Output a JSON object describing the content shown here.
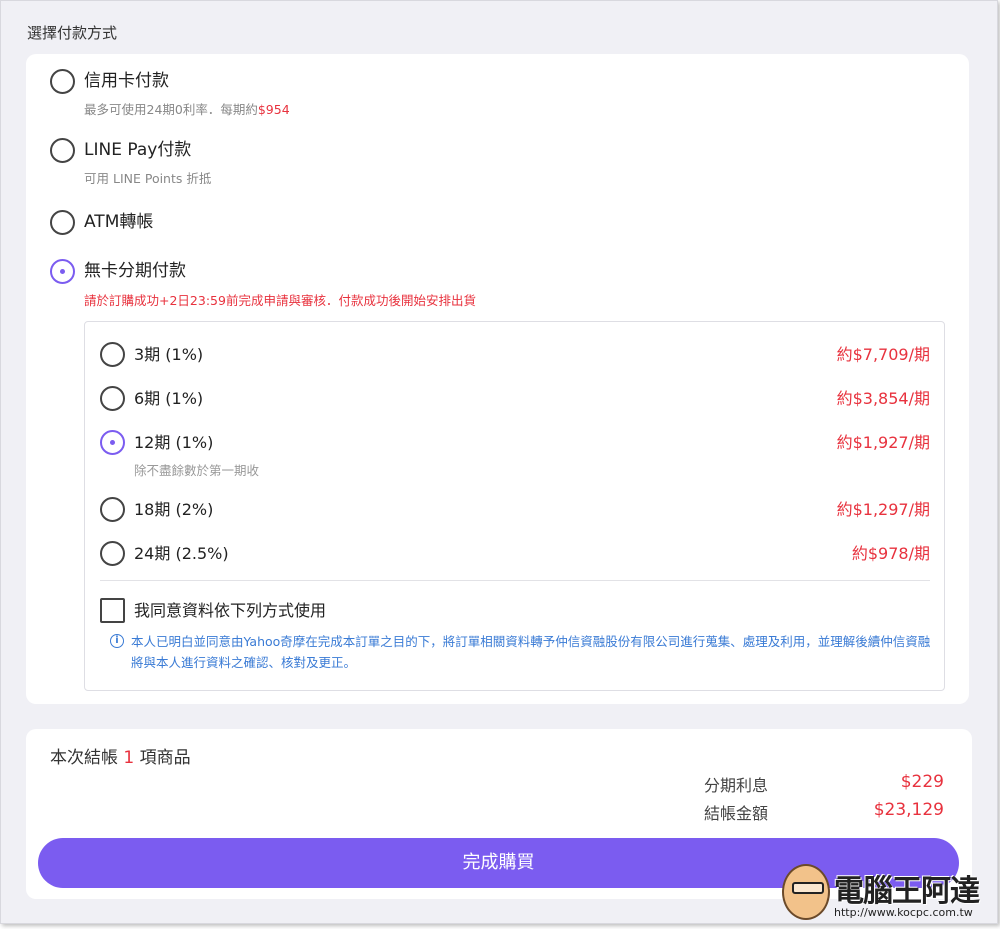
{
  "section_title": "選擇付款方式",
  "payment_methods": [
    {
      "label": "信用卡付款",
      "sub_prefix": "最多可使用24期0利率．每期約",
      "sub_amount": "$954",
      "selected": false
    },
    {
      "label": "LINE Pay付款",
      "sub": "可用 LINE Points 折抵",
      "selected": false
    },
    {
      "label": "ATM轉帳",
      "selected": false
    },
    {
      "label": "無卡分期付款",
      "sub_warning": "請於訂購成功+2日23:59前完成申請與審核．付款成功後開始安排出貨",
      "selected": true
    }
  ],
  "installments": [
    {
      "label": "3期 (1%)",
      "price": "約$7,709/期",
      "selected": false
    },
    {
      "label": "6期 (1%)",
      "price": "約$3,854/期",
      "selected": false
    },
    {
      "label": "12期 (1%)",
      "price": "約$1,927/期",
      "note": "除不盡餘數於第一期收",
      "selected": true
    },
    {
      "label": "18期 (2%)",
      "price": "約$1,297/期",
      "selected": false
    },
    {
      "label": "24期 (2.5%)",
      "price": "約$978/期",
      "selected": false
    }
  ],
  "consent": {
    "label": "我同意資料依下列方式使用",
    "info_icon": "info-icon",
    "info_text": "本人已明白並同意由Yahoo奇摩在完成本訂單之目的下，將訂單相關資料轉予仲信資融股份有限公司進行蒐集、處理及利用，並理解後續仲信資融將與本人進行資料之確認、核對及更正。"
  },
  "summary": {
    "title_prefix": "本次結帳",
    "count": "1",
    "title_suffix": "項商品",
    "interest_label": "分期利息",
    "interest_value": "$229",
    "total_label": "結帳金額",
    "total_value": "$23,129",
    "buy_label": "完成購買"
  },
  "watermark": {
    "text": "電腦王阿達",
    "url": "http://www.kocpc.com.tw"
  },
  "colors": {
    "accent": "#7b5cf0",
    "price_red": "#e8323e",
    "info_blue": "#3a7bd5",
    "background": "#f0f0f5"
  }
}
